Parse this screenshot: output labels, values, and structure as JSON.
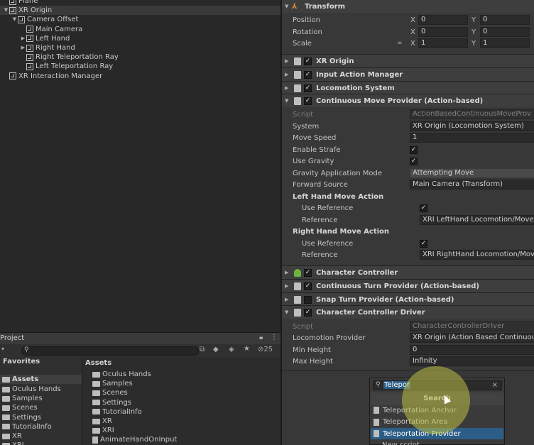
{
  "hierarchy": {
    "items": [
      {
        "label": "Plane",
        "indent": 1,
        "arrow": ""
      },
      {
        "label": "XR Origin",
        "indent": 1,
        "arrow": "▼",
        "selected": true
      },
      {
        "label": "Camera Offset",
        "indent": 2,
        "arrow": "▼"
      },
      {
        "label": "Main Camera",
        "indent": 3,
        "arrow": ""
      },
      {
        "label": "Left Hand",
        "indent": 3,
        "arrow": "▶"
      },
      {
        "label": "Right Hand",
        "indent": 3,
        "arrow": "▶"
      },
      {
        "label": "Right Teleportation Ray",
        "indent": 3,
        "arrow": ""
      },
      {
        "label": "Left Teleportation Ray",
        "indent": 3,
        "arrow": ""
      },
      {
        "label": "XR Interaction Manager",
        "indent": 1,
        "arrow": ""
      }
    ]
  },
  "inspector": {
    "transform": {
      "title": "Transform",
      "position_label": "Position",
      "rotation_label": "Rotation",
      "scale_label": "Scale",
      "x": "X",
      "y": "Y",
      "pos_x": "0",
      "pos_y": "0",
      "rot_x": "0",
      "rot_y": "0",
      "scale_x": "1",
      "scale_y": "1"
    },
    "components": {
      "xr_origin": "XR Origin",
      "input_action_manager": "Input Action Manager",
      "locomotion_system": "Locomotion System",
      "continuous_move": "Continuous Move Provider (Action-based)",
      "character_controller": "Character Controller",
      "continuous_turn": "Continuous Turn Provider (Action-based)",
      "snap_turn": "Snap Turn Provider (Action-based)",
      "cc_driver": "Character Controller Driver"
    },
    "move": {
      "script_label": "Script",
      "script_value": "ActionBasedContinuousMoveProv",
      "system_label": "System",
      "system_value": "XR Origin (Locomotion System)",
      "speed_label": "Move Speed",
      "speed_value": "1",
      "strafe_label": "Enable Strafe",
      "gravity_label": "Use Gravity",
      "gravity_mode_label": "Gravity Application Mode",
      "gravity_mode_value": "Attempting Move",
      "forward_label": "Forward Source",
      "forward_value": "Main Camera (Transform)",
      "left_section": "Left Hand Move Action",
      "use_ref_label": "Use Reference",
      "ref_label": "Reference",
      "left_ref_value": "XRI LeftHand Locomotion/Move",
      "right_section": "Right Hand Move Action",
      "right_ref_value": "XRI RightHand Locomotion/Mov"
    },
    "driver": {
      "script_label": "Script",
      "script_value": "CharacterControllerDriver",
      "loco_label": "Locomotion Provider",
      "loco_value": "XR Origin (Action Based Continuou",
      "min_label": "Min Height",
      "min_value": "0",
      "max_label": "Max Height",
      "max_value": "Infinity"
    }
  },
  "project": {
    "tab": "Project",
    "count": "25",
    "favorites": "Favorites",
    "assets_root": "Assets",
    "left_items": [
      "Oculus Hands",
      "Samples",
      "Scenes",
      "Settings",
      "TutorialInfo",
      "XR",
      "XRI"
    ],
    "right_header": "Assets",
    "right_items": [
      {
        "label": "Oculus Hands",
        "kind": "folder"
      },
      {
        "label": "Samples",
        "kind": "folder"
      },
      {
        "label": "Scenes",
        "kind": "folder"
      },
      {
        "label": "Settings",
        "kind": "folder"
      },
      {
        "label": "TutorialInfo",
        "kind": "folder"
      },
      {
        "label": "XR",
        "kind": "folder"
      },
      {
        "label": "XRI",
        "kind": "folder"
      },
      {
        "label": "AnimateHandOnInput",
        "kind": "file"
      }
    ]
  },
  "add_component": {
    "query": "Telepor",
    "search_label": "Search",
    "results": [
      "Teleportation Anchor",
      "Teleportation Area",
      "Teleportation Provider"
    ],
    "selected_index": 2,
    "next": "New script"
  }
}
